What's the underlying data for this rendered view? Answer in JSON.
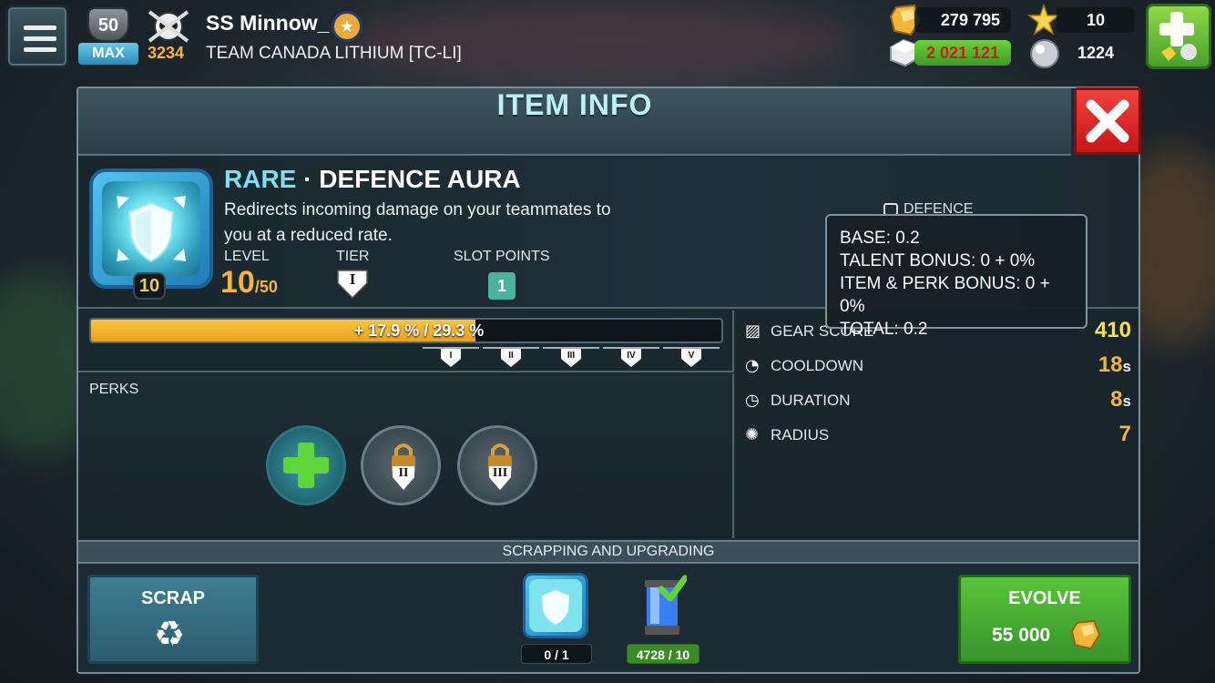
{
  "header": {
    "player_level": "50",
    "level_badge": "MAX",
    "trophies": "3234",
    "player_name": "SS Minnow_",
    "team_name": "TEAM CANADA LITHIUM [TC-LI]"
  },
  "resources": {
    "gold": "279 795",
    "stars": "10",
    "silver": "2 021 121",
    "pearls": "1224"
  },
  "modal": {
    "title": "ITEM INFO",
    "item": {
      "rarity": "RARE",
      "name": "DEFENCE AURA",
      "separator": "·",
      "description": "Redirects incoming damage on your teammates to you at a reduced rate.",
      "level_label": "LEVEL",
      "level": "10",
      "level_max": "/50",
      "icon_level": "10",
      "tier_label": "TIER",
      "tier": "I",
      "slot_points_label": "SLOT POINTS",
      "slot_points": "1",
      "defence_label": "DEFENCE"
    },
    "progress": {
      "text": "+ 17.9 % / 29.3 %",
      "fraction": 0.61,
      "tiers": [
        "I",
        "II",
        "III",
        "IV",
        "V"
      ]
    },
    "perks": {
      "label": "PERKS",
      "slots": [
        {
          "type": "add",
          "tier": ""
        },
        {
          "type": "locked",
          "tier": "II"
        },
        {
          "type": "locked",
          "tier": "III"
        }
      ]
    },
    "stats": [
      {
        "label": "GEAR SCORE",
        "value": "410",
        "unit": "",
        "icon": "gear-score-icon"
      },
      {
        "label": "COOLDOWN",
        "value": "18",
        "unit": "s",
        "icon": "cooldown-icon"
      },
      {
        "label": "DURATION",
        "value": "8",
        "unit": "s",
        "icon": "duration-icon"
      },
      {
        "label": "RADIUS",
        "value": "7",
        "unit": "",
        "icon": "radius-icon"
      }
    ],
    "tooltip": {
      "base": "BASE: 0.2",
      "talent": "TALENT BONUS: 0 + 0%",
      "item_perk": "ITEM & PERK BONUS: 0 + 0%",
      "total": "TOTAL: 0.2"
    },
    "scrapping": {
      "header": "SCRAPPING AND UPGRADING",
      "scrap_label": "SCRAP",
      "evolve_label": "EVOLVE",
      "evolve_cost": "55 000",
      "req_item_count": "0 / 1",
      "req_canister_count": "4728 / 10"
    }
  },
  "colors": {
    "accent_gold": "#f5b53a",
    "rarity_cyan": "#7de0f2",
    "evolve_green": "#58c43a",
    "close_red": "#e02a28"
  }
}
